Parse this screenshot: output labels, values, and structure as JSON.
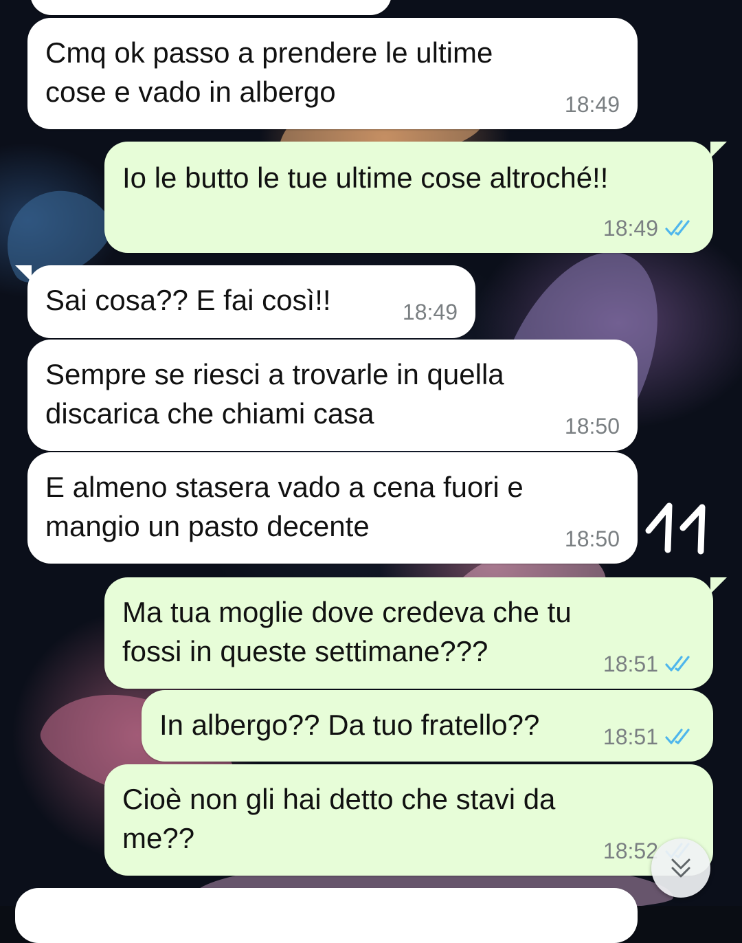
{
  "chat": {
    "messages": [
      {
        "direction": "incoming",
        "text": "Cmq ok passo a prendere le ultime\ncose e vado in albergo",
        "time": "18:49"
      },
      {
        "direction": "outgoing",
        "text": "Io le butto le tue ultime cose altroché!!",
        "time": "18:49",
        "status": "read",
        "status_icon": "double-check-icon"
      },
      {
        "direction": "incoming",
        "text": "Sai cosa?? E fai così!!",
        "time": "18:49"
      },
      {
        "direction": "incoming",
        "text": "Sempre se riesci a trovarle in quella\ndiscarica che chiami casa",
        "time": "18:50"
      },
      {
        "direction": "incoming",
        "text": "E almeno stasera vado a cena fuori e\nmangio un pasto decente",
        "time": "18:50"
      },
      {
        "direction": "outgoing",
        "text": "Ma tua moglie dove credeva che tu\nfossi in queste settimane???",
        "time": "18:51",
        "status": "read",
        "status_icon": "double-check-icon"
      },
      {
        "direction": "outgoing",
        "text": "In albergo?? Da tuo fratello??",
        "time": "18:51",
        "status": "read",
        "status_icon": "double-check-icon"
      },
      {
        "direction": "outgoing",
        "text": "Cioè non gli hai detto che stavi da\nme??",
        "time": "18:52",
        "status": "read",
        "status_icon": "double-check-icon"
      }
    ]
  },
  "annotation": {
    "text": "11"
  },
  "controls": {
    "scroll_down_icon": "double-chevron-down-icon"
  },
  "colors": {
    "incoming_bubble": "#ffffff",
    "outgoing_bubble": "#e7fdd8",
    "read_tick": "#4fb6ec",
    "time_text": "#7a7f82"
  }
}
